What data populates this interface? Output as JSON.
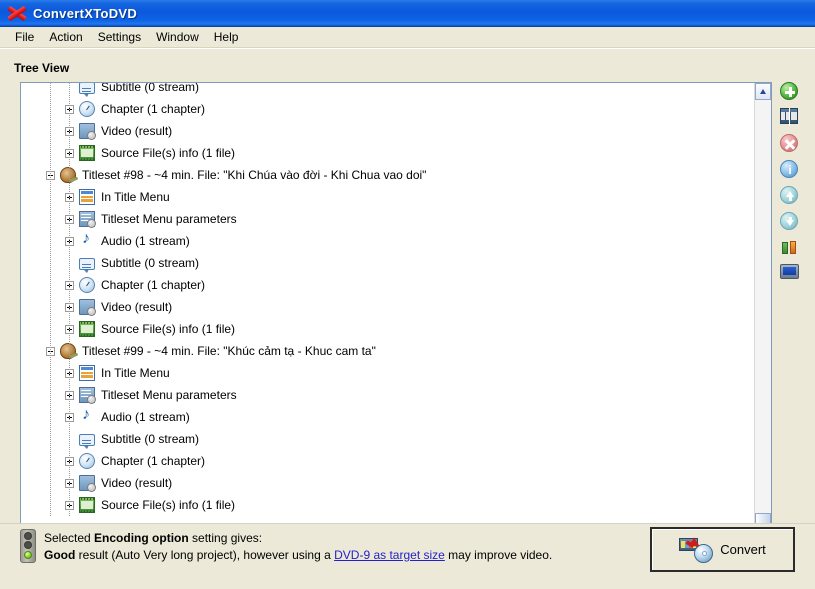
{
  "window": {
    "title": "ConvertXToDVD",
    "logo_icon": "red-x-logo"
  },
  "menubar": {
    "items": [
      {
        "label": "File"
      },
      {
        "label": "Action"
      },
      {
        "label": "Settings"
      },
      {
        "label": "Window"
      },
      {
        "label": "Help"
      }
    ]
  },
  "panel": {
    "label": "Tree View"
  },
  "tree": {
    "rows": [
      {
        "level": 2,
        "toggle": "none",
        "icon": "subtitle-icon",
        "label": "Subtitle (0 stream)"
      },
      {
        "level": 2,
        "toggle": "plus",
        "icon": "clock-icon",
        "label": "Chapter (1 chapter)"
      },
      {
        "level": 2,
        "toggle": "plus",
        "icon": "video-icon",
        "label": "Video (result)"
      },
      {
        "level": 2,
        "toggle": "plus",
        "icon": "source-file-icon",
        "label": "Source File(s) info (1 file)"
      },
      {
        "level": 1,
        "toggle": "minus",
        "icon": "titleset-icon",
        "label": "Titleset #98 - ~4 min. File: \"Khi Chúa vào đời - Khi Chua vao doi\""
      },
      {
        "level": 2,
        "toggle": "plus",
        "icon": "title-menu-icon",
        "label": "In Title Menu"
      },
      {
        "level": 2,
        "toggle": "plus",
        "icon": "menu-params-icon",
        "label": "Titleset Menu parameters"
      },
      {
        "level": 2,
        "toggle": "plus",
        "icon": "audio-icon",
        "label": "Audio (1 stream)"
      },
      {
        "level": 2,
        "toggle": "none",
        "icon": "subtitle-icon",
        "label": "Subtitle (0 stream)"
      },
      {
        "level": 2,
        "toggle": "plus",
        "icon": "clock-icon",
        "label": "Chapter (1 chapter)"
      },
      {
        "level": 2,
        "toggle": "plus",
        "icon": "video-icon",
        "label": "Video (result)"
      },
      {
        "level": 2,
        "toggle": "plus",
        "icon": "source-file-icon",
        "label": "Source File(s) info (1 file)"
      },
      {
        "level": 1,
        "toggle": "minus",
        "icon": "titleset-icon",
        "label": "Titleset #99 - ~4 min. File: \"Khúc cảm tạ - Khuc cam ta\""
      },
      {
        "level": 2,
        "toggle": "plus",
        "icon": "title-menu-icon",
        "label": "In Title Menu"
      },
      {
        "level": 2,
        "toggle": "plus",
        "icon": "menu-params-icon",
        "label": "Titleset Menu parameters"
      },
      {
        "level": 2,
        "toggle": "plus",
        "icon": "audio-icon",
        "label": "Audio (1 stream)"
      },
      {
        "level": 2,
        "toggle": "none",
        "icon": "subtitle-icon",
        "label": "Subtitle (0 stream)"
      },
      {
        "level": 2,
        "toggle": "plus",
        "icon": "clock-icon",
        "label": "Chapter (1 chapter)"
      },
      {
        "level": 2,
        "toggle": "plus",
        "icon": "video-icon",
        "label": "Video (result)"
      },
      {
        "level": 2,
        "toggle": "plus",
        "icon": "source-file-icon",
        "label": "Source File(s) info (1 file)"
      }
    ]
  },
  "toolbar": {
    "buttons": [
      {
        "icon": "add-title-icon"
      },
      {
        "icon": "split-film-icon"
      },
      {
        "icon": "remove-title-icon"
      },
      {
        "icon": "info-icon"
      },
      {
        "icon": "move-up-icon"
      },
      {
        "icon": "move-down-icon"
      },
      {
        "icon": "edit-tools-icon"
      },
      {
        "icon": "preview-screen-icon"
      }
    ]
  },
  "status": {
    "icon": "traffic-light-green-icon",
    "line1_prefix": "Selected ",
    "line1_bold": "Encoding option",
    "line1_suffix": " setting gives:",
    "line2_bold": "Good",
    "line2_mid": " result (Auto Very long project), however using a ",
    "line2_link": "DVD-9 as target size",
    "line2_end": " may improve video."
  },
  "convert": {
    "label": "Convert",
    "icon": "film-to-disc-icon"
  },
  "colors": {
    "titlebar_blue": "#0b58dd",
    "face": "#ece9d8",
    "link": "#2222cc",
    "tree_bg": "#ffffff",
    "border": "#7f9db9"
  }
}
